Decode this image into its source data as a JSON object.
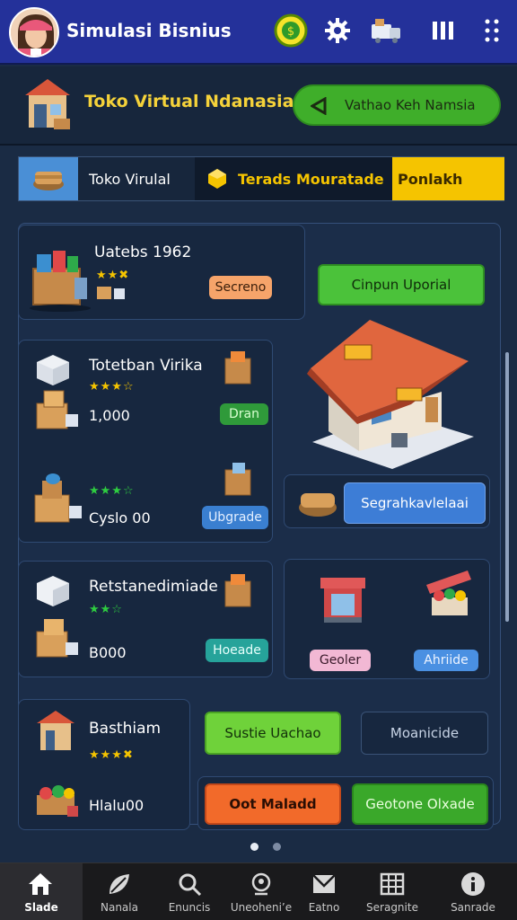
{
  "header": {
    "app_title": "Simulasi Bisnius",
    "icons": [
      "avatar",
      "coin-icon",
      "gear-icon",
      "delivery-icon",
      "pause-icon",
      "more-icon"
    ]
  },
  "shop": {
    "name": "Toko Virtual Ndanasia",
    "visit_label": "Vathao Keh Namsia"
  },
  "tabs": [
    {
      "label": "Toko Virulal"
    },
    {
      "label": "Terads Mouratade"
    },
    {
      "label": "Ponlakh"
    }
  ],
  "cards": {
    "featured": {
      "title": "Uatebs 1962",
      "badge": "Secreno",
      "action": "Cinpun Uporial"
    },
    "item1": {
      "title": "Totetban Virika",
      "value": "1,000",
      "button": "Dran"
    },
    "item2": {
      "value": "Cyslo 00",
      "button": "Ubgrade"
    },
    "shop_action": {
      "button": "Segrahkavlelaai"
    },
    "item3": {
      "title": "Retstanedimiade",
      "value": "B000",
      "button": "Hoeade"
    },
    "mini": {
      "left_button": "Geoler",
      "right_button": "Ahriide"
    },
    "item4": {
      "title": "Basthiam",
      "value": "Hlalu00"
    },
    "actions": {
      "green1": "Sustie Uachao",
      "outline": "Moanicide",
      "orange": "Oot Maladd",
      "green2": "Geotone Olxade"
    }
  },
  "nav": [
    {
      "label": "Slade",
      "icon": "home-icon",
      "active": true
    },
    {
      "label": "Nanala",
      "icon": "leaf-icon"
    },
    {
      "label": "Enuncis",
      "icon": "search-icon"
    },
    {
      "label": "Uneoheni’e",
      "icon": "profile-icon"
    },
    {
      "label": "Eatno",
      "icon": "mail-icon"
    },
    {
      "label": "Seragnite",
      "icon": "grid-icon"
    },
    {
      "label": "Sanrade",
      "icon": "info-icon"
    }
  ],
  "colors": {
    "topbar": "#24319a",
    "accent_yellow": "#f5c400",
    "green": "#3fae2a",
    "bg": "#1a2b44"
  },
  "pager": {
    "active": 1,
    "total": 2
  }
}
